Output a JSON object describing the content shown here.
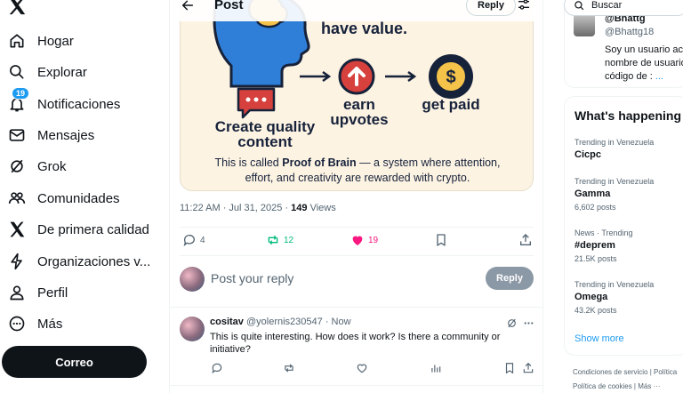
{
  "sidebar": {
    "items": [
      {
        "label": "Hogar",
        "icon": "home-icon"
      },
      {
        "label": "Explorar",
        "icon": "search-icon"
      },
      {
        "label": "Notificaciones",
        "icon": "bell-icon",
        "badge": "19"
      },
      {
        "label": "Mensajes",
        "icon": "mail-icon"
      },
      {
        "label": "Grok",
        "icon": "grok-icon"
      },
      {
        "label": "Comunidades",
        "icon": "people-icon"
      },
      {
        "label": "De primera calidad",
        "icon": "x-icon"
      },
      {
        "label": "Organizaciones v...",
        "icon": "lightning-icon"
      },
      {
        "label": "Perfil",
        "icon": "person-icon"
      },
      {
        "label": "Más",
        "icon": "more-circle-icon"
      }
    ],
    "post_button": "Correo"
  },
  "header": {
    "title": "Post",
    "reply_pill": "Reply"
  },
  "image": {
    "title": "have value.",
    "step1": "Create quality content",
    "step2": "earn upvotes",
    "step3": "get paid",
    "caption_line1_pre": "This is called ",
    "caption_line1_bold": "Proof of Brain",
    "caption_line1_post": " — a system where attention,",
    "caption_line2": "effort, and creativity are rewarded with crypto."
  },
  "post_meta": {
    "time": "11:22 AM · Jul 31, 2025 · ",
    "views_count": "149",
    "views_label": " Views"
  },
  "actions": {
    "replies": "4",
    "reposts": "12",
    "likes": "19"
  },
  "reply_box": {
    "placeholder": "Post your reply",
    "button": "Reply"
  },
  "comment": {
    "name": "cositav",
    "handle": "@yolernis230547 · Now",
    "text": "This is quite interesting. How does it work? Is there a community or initiative?"
  },
  "right": {
    "search_placeholder": "Buscar",
    "profile": {
      "name": "@Bhattg",
      "handle": "@Bhattg18",
      "bio1": "Soy un usuario act",
      "bio2": "nombre de usuario",
      "bio3": "código de :",
      "bio3_more": "..."
    },
    "trends_title": "What's happening",
    "trends": [
      {
        "category": "Trending in Venezuela",
        "name": "Cicpc",
        "posts": ""
      },
      {
        "category": "Trending in Venezuela",
        "name": "Gamma",
        "posts": "6,602 posts"
      },
      {
        "category": "News · Trending",
        "name": "#deprem",
        "posts": "21.5K posts"
      },
      {
        "category": "Trending in Venezuela",
        "name": "Omega",
        "posts": "43.2K posts"
      }
    ],
    "show_more": "Show more",
    "footer1": "Condiciones de servicio  |  Política",
    "footer2": "Política de cookies  |  Más ···"
  },
  "colors": {
    "accent": "#1d9bf0",
    "repost": "#00ba7c",
    "like": "#f91880",
    "dark": "#0f1419"
  }
}
